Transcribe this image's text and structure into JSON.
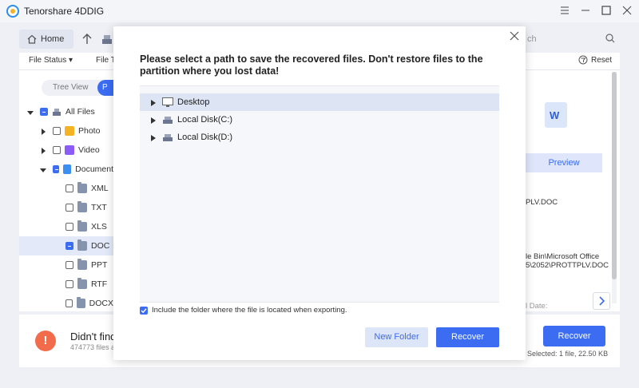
{
  "app": {
    "title": "Tenorshare 4DDIG"
  },
  "toolbar": {
    "home_label": "Home",
    "search_placeholder": "ch"
  },
  "filters": {
    "file_status": "File Status",
    "file_type": "File T",
    "reset": "Reset"
  },
  "left": {
    "tree_view": "Tree View",
    "path_view": "P",
    "items": [
      {
        "label": "All Files"
      },
      {
        "label": "Photo"
      },
      {
        "label": "Video"
      },
      {
        "label": "Document"
      },
      {
        "label": "XML"
      },
      {
        "label": "TXT"
      },
      {
        "label": "XLS"
      },
      {
        "label": "DOC"
      },
      {
        "label": "PPT"
      },
      {
        "label": "RTF"
      },
      {
        "label": "DOCX"
      }
    ]
  },
  "right": {
    "file_badge": "W",
    "preview": "Preview",
    "name_partial": "PLV.DOC",
    "path_line1": "le Bin\\Microsoft Office",
    "path_line2": "5\\2052\\PROTTPLV.DOC",
    "date_partial": "l Date:"
  },
  "bottom": {
    "warn_symbol": "!",
    "title": "Didn't find",
    "subtitle": "474773 files a",
    "recover": "Recover",
    "selected": "Selected: 1 file, 22.50 KB"
  },
  "dialog": {
    "title": "Please select a path to save the recovered files. Don't restore files to the partition where you lost data!",
    "paths": [
      {
        "label": "Desktop",
        "icon": "monitor-icon"
      },
      {
        "label": "Local Disk(C:)",
        "icon": "disk-icon"
      },
      {
        "label": "Local Disk(D:)",
        "icon": "disk-icon"
      }
    ],
    "include_label": "Include the folder where the file is located when exporting.",
    "new_folder": "New Folder",
    "recover": "Recover"
  },
  "colors": {
    "accent": "#3b6cf2",
    "warning": "#f26b4a"
  }
}
